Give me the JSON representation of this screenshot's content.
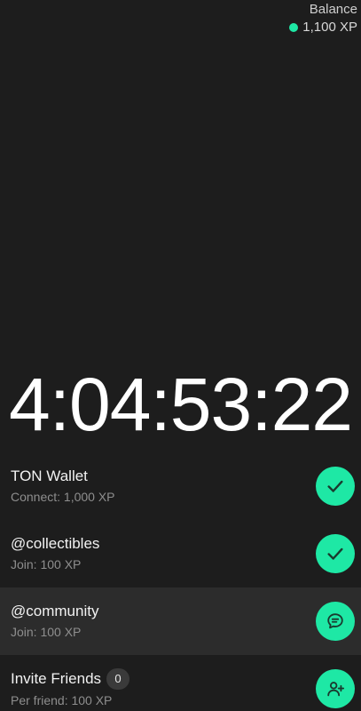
{
  "balance": {
    "label": "Balance",
    "value": "1,100 XP",
    "dot_color": "#1ee8a5"
  },
  "countdown": "4:04:53:22",
  "accent_color": "#1ee8a5",
  "tasks": [
    {
      "title": "TON Wallet",
      "subtitle": "Connect: 1,000 XP",
      "icon": "check-icon",
      "badge": ""
    },
    {
      "title": "@collectibles",
      "subtitle": "Join: 100 XP",
      "icon": "check-icon",
      "badge": ""
    },
    {
      "title": "@community",
      "subtitle": "Join: 100 XP",
      "icon": "chat-bubble-icon",
      "badge": ""
    },
    {
      "title": "Invite Friends",
      "subtitle": "Per friend: 100 XP",
      "icon": "add-user-icon",
      "badge": "0"
    }
  ]
}
